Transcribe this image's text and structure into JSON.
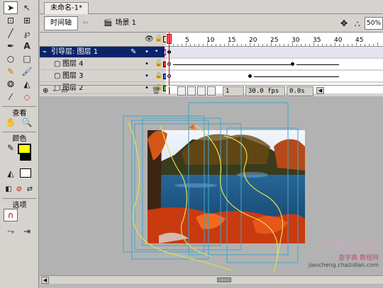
{
  "document": {
    "tab_title": "未命名-1*"
  },
  "edit_bar": {
    "timeline_button": "时间轴",
    "scene_label": "场景 1",
    "zoom": "50%"
  },
  "tools": {
    "view_title": "查看",
    "colors_title": "颜色",
    "options_title": "选项",
    "stroke_color": "#000000",
    "fill_color": "#ffff00"
  },
  "timeline": {
    "ruler": [
      "1",
      "5",
      "10",
      "15",
      "20",
      "25",
      "30",
      "35",
      "40",
      "45"
    ],
    "layers": [
      {
        "name": "引导层: 图层 1",
        "color": "#cc66ff",
        "active": true
      },
      {
        "name": "图层 4",
        "color": "#ff3333",
        "active": false
      },
      {
        "name": "图层 3",
        "color": "#3366ff",
        "active": false
      },
      {
        "name": "图层 2",
        "color": "#33cc33",
        "active": false
      }
    ],
    "status": {
      "current_frame": "1",
      "fps": "30.0 fps",
      "time": "0.0s"
    }
  },
  "watermark": {
    "line1": "中国教程网",
    "line2": "查字典 教程网",
    "line3": "jiaocheng.chazidian.com"
  }
}
